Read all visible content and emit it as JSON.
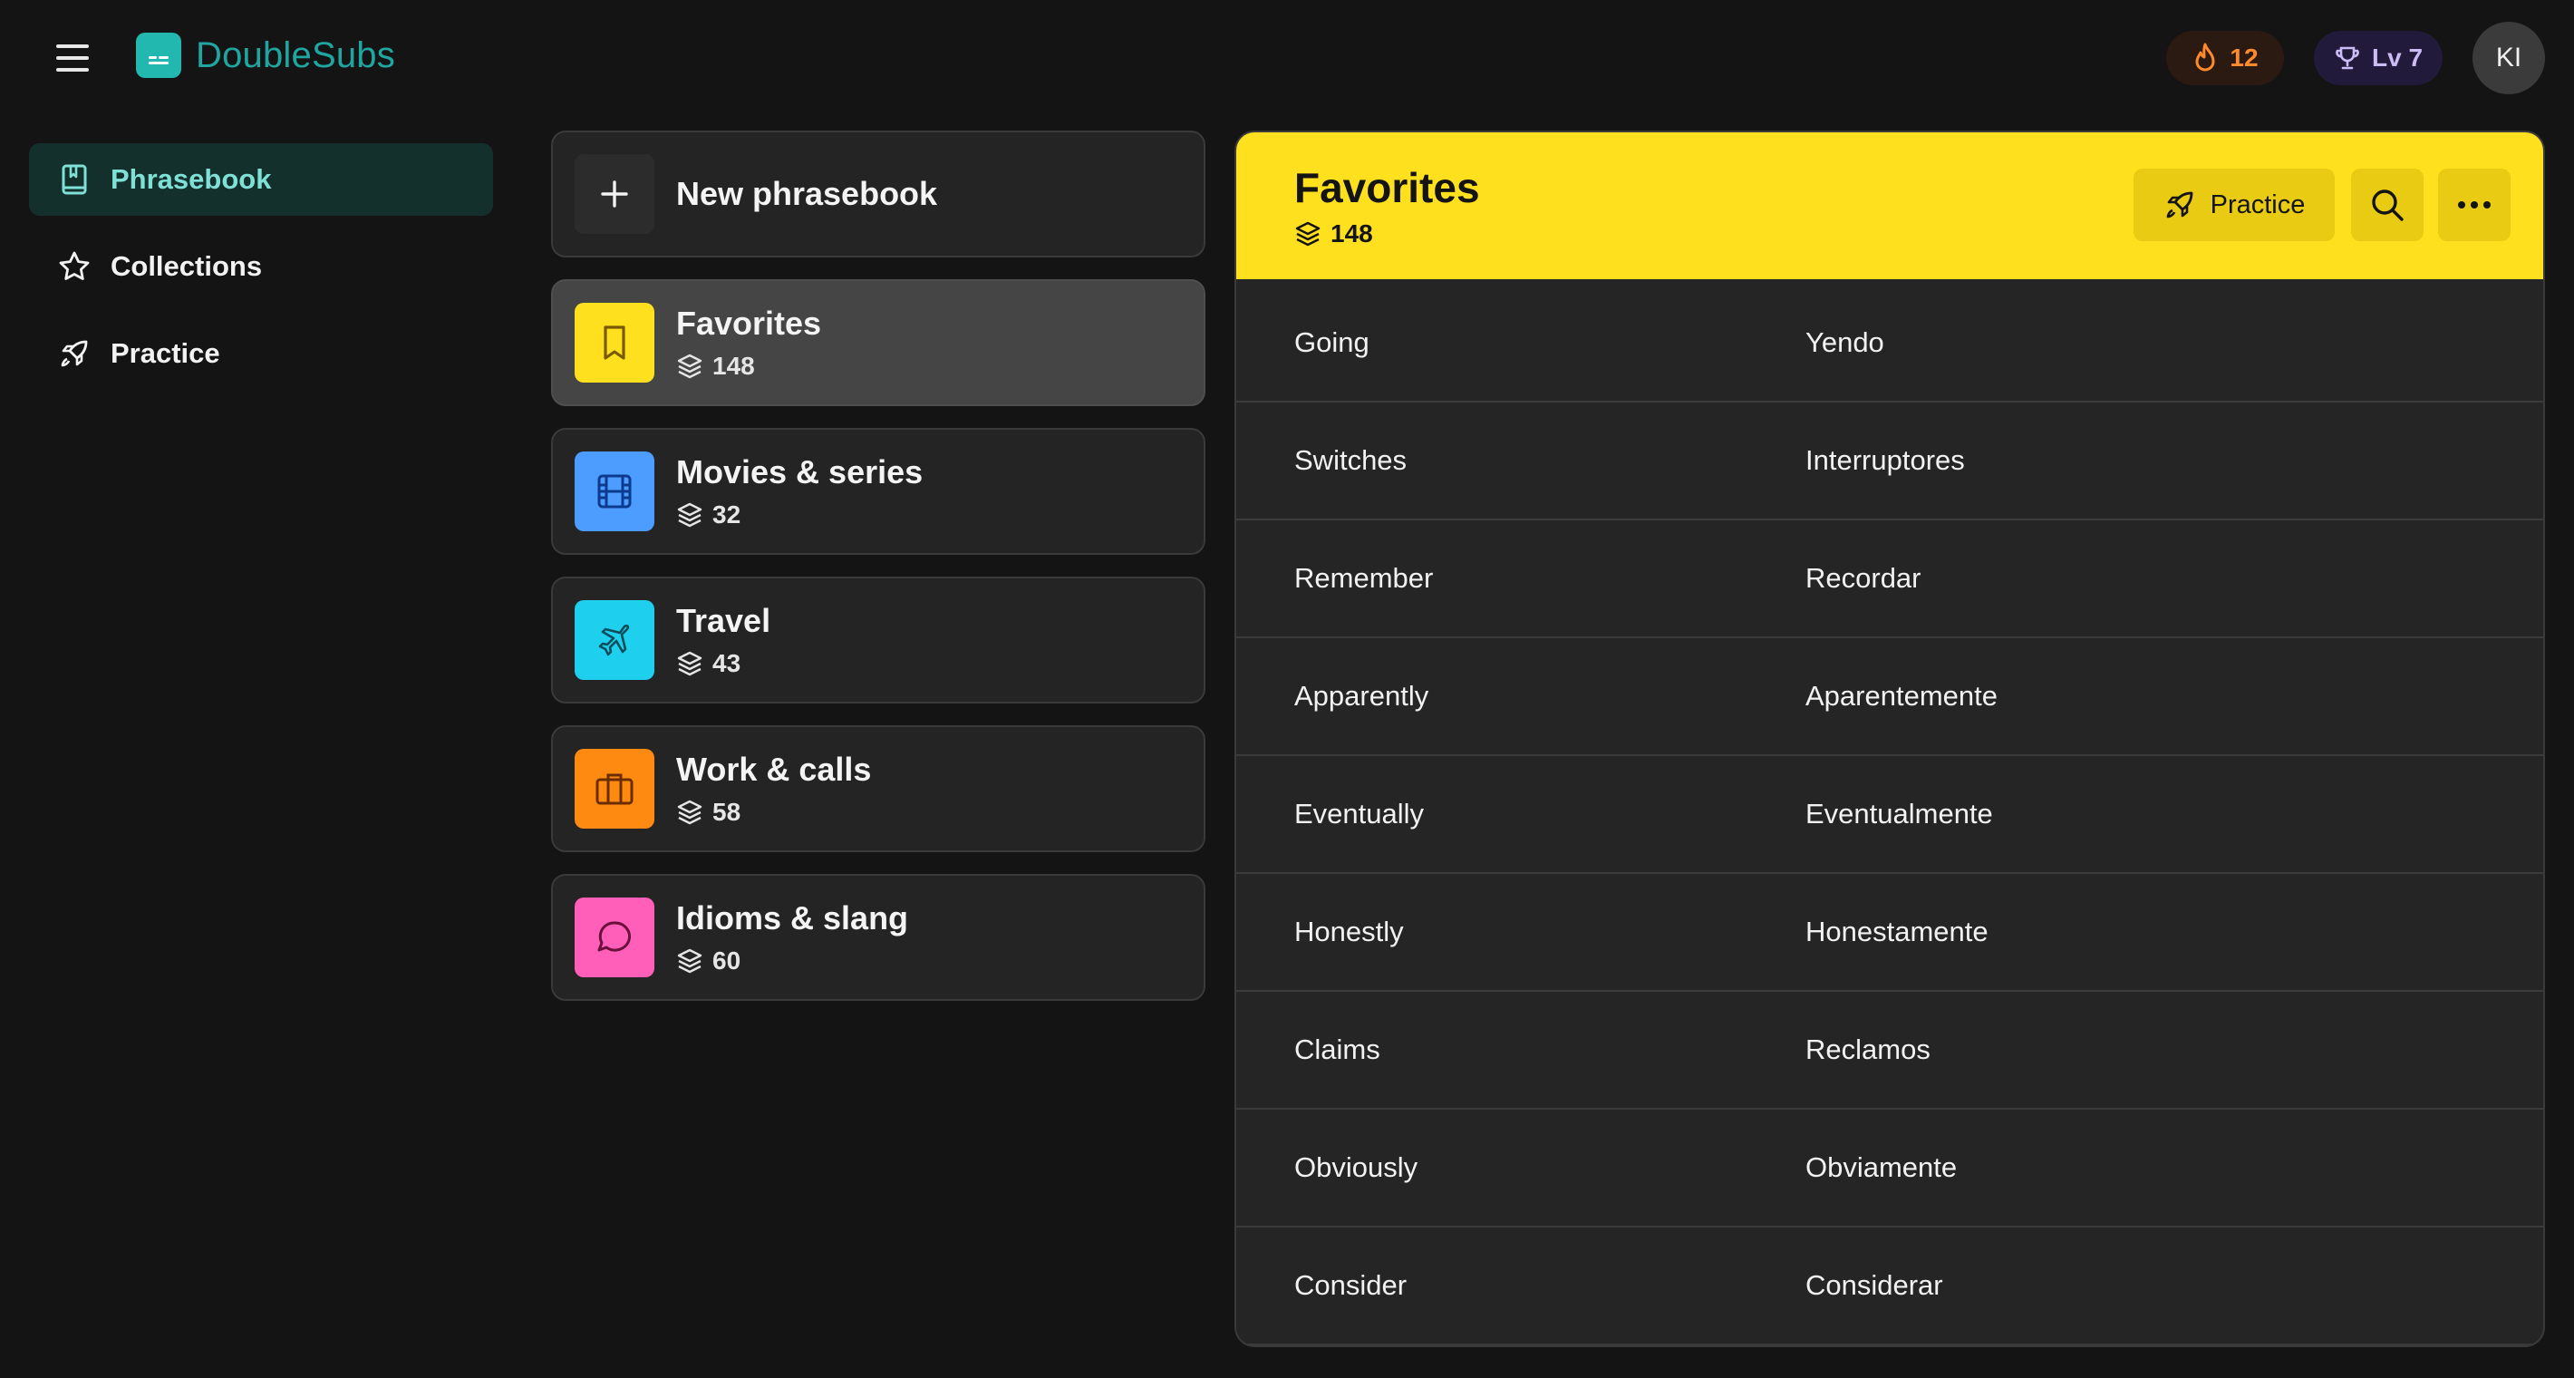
{
  "app": {
    "name": "DoubleSubs",
    "menu_icon": "hamburger-icon",
    "logo_icon": "subtitles-icon",
    "accent": "#1fa6a0"
  },
  "header": {
    "streak": {
      "icon": "flame-icon",
      "value": "12",
      "color": "#ff8a2b"
    },
    "level": {
      "icon": "trophy-icon",
      "label": "Lv 7",
      "color": "#cbbcf5"
    },
    "avatar_initials": "KI"
  },
  "sidebar": {
    "items": [
      {
        "label": "Phrasebook",
        "icon": "book-icon",
        "active": true
      },
      {
        "label": "Collections",
        "icon": "star-icon",
        "active": false
      },
      {
        "label": "Practice",
        "icon": "rocket-icon",
        "active": false
      }
    ]
  },
  "phrasebooks": {
    "new_label": "New phrasebook",
    "items": [
      {
        "title": "Favorites",
        "count": "148",
        "icon": "bookmark-icon",
        "color": "#ffe01f",
        "selected": true
      },
      {
        "title": "Movies & series",
        "count": "32",
        "icon": "film-icon",
        "color": "#4d9cff",
        "selected": false
      },
      {
        "title": "Travel",
        "count": "43",
        "icon": "plane-icon",
        "color": "#1fd0ee",
        "selected": false
      },
      {
        "title": "Work & calls",
        "count": "58",
        "icon": "briefcase-icon",
        "color": "#ff8a12",
        "selected": false
      },
      {
        "title": "Idioms & slang",
        "count": "60",
        "icon": "chat-bubble-icon",
        "color": "#ff5fb8",
        "selected": false
      }
    ]
  },
  "detail": {
    "title": "Favorites",
    "count": "148",
    "header_color": "#ffe01f",
    "practice_label": "Practice",
    "rows": [
      {
        "source": "Going",
        "target": "Yendo"
      },
      {
        "source": "Switches",
        "target": "Interruptores"
      },
      {
        "source": "Remember",
        "target": "Recordar"
      },
      {
        "source": "Apparently",
        "target": "Aparentemente"
      },
      {
        "source": "Eventually",
        "target": "Eventualmente"
      },
      {
        "source": "Honestly",
        "target": "Honestamente"
      },
      {
        "source": "Claims",
        "target": "Reclamos"
      },
      {
        "source": "Obviously",
        "target": "Obviamente"
      },
      {
        "source": "Consider",
        "target": "Considerar"
      }
    ]
  }
}
